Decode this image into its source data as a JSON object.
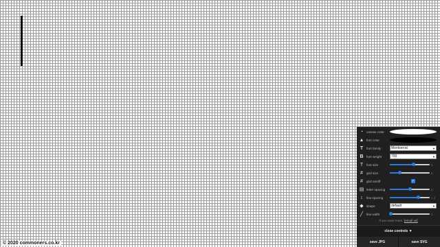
{
  "footer": {
    "text": "© 2020 commoners.co.kr"
  },
  "controls": {
    "canvas_color": {
      "label": "canvas color",
      "value": "#ffffff"
    },
    "font_color": {
      "label": "font color",
      "value": "#000000"
    },
    "font_family": {
      "label": "font family",
      "value": "Montserrat"
    },
    "font_weight": {
      "label": "font weight",
      "value": "700"
    },
    "font_size": {
      "label": "font size",
      "value": "5",
      "level": 0.6
    },
    "grid_size": {
      "label": "grid size",
      "value": "5",
      "level": 0.25
    },
    "grid_onoff": {
      "label": "grid on/off",
      "checked": true
    },
    "letter_spacing": {
      "label": "letter spacing",
      "value": "0",
      "level": 0.5
    },
    "line_spacing": {
      "label": "line spacing",
      "value": "1.2",
      "level": 0.72
    },
    "shape": {
      "label": "shape",
      "value": "default"
    },
    "line_width": {
      "label": "line width",
      "value": "0",
      "level": 0.02
    }
  },
  "more_text": "If you want more, ",
  "more_link": "[email us]",
  "close_label": "close controls ▼",
  "save_jpg": "save JPG",
  "save_svg": "save SVG",
  "icons": [
    "palette-icon",
    "drop-icon",
    "text-icon",
    "bold-icon",
    "text-size-icon",
    "grid-icon",
    "grid-icon",
    "letter-spacing-icon",
    "line-spacing-icon",
    "shapes-icon",
    "line-icon"
  ]
}
